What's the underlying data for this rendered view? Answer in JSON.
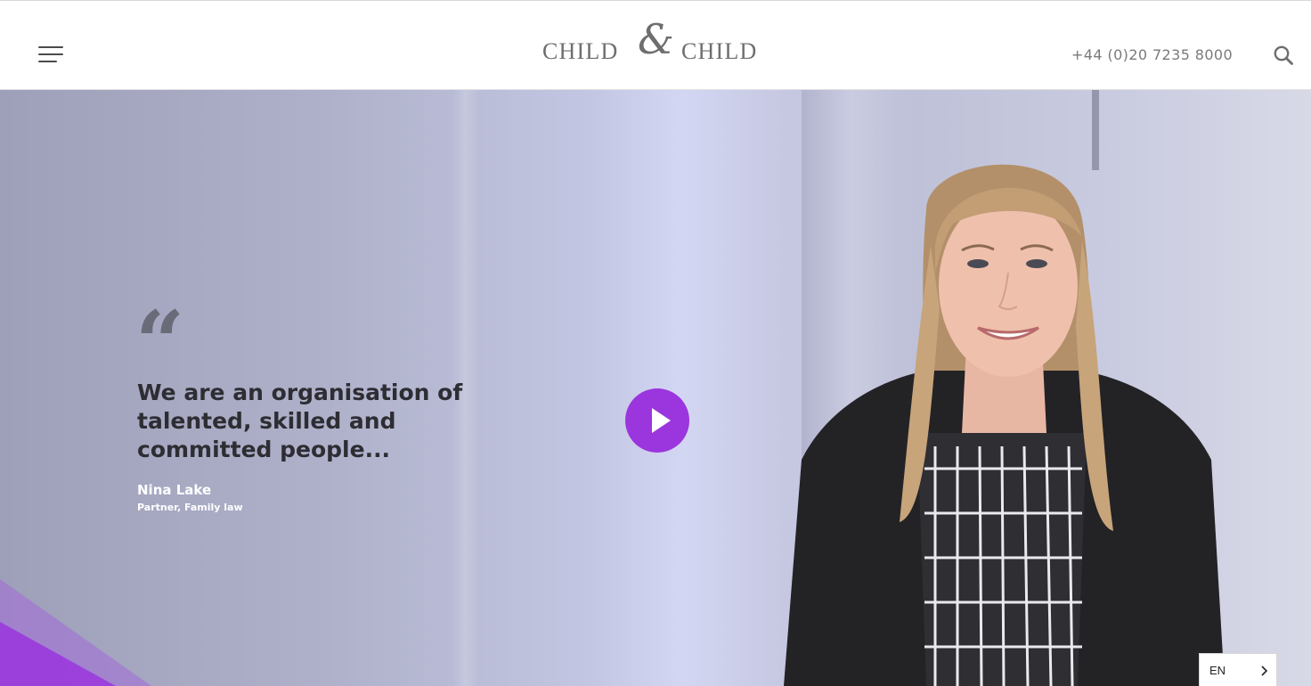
{
  "header": {
    "logo": {
      "word_left": "CHILD",
      "ampersand": "&",
      "word_right": "CHILD"
    },
    "phone": "+44 (0)20 7235 8000",
    "menu_icon": "hamburger-menu-icon",
    "search_icon": "search-icon"
  },
  "hero": {
    "quote_mark": "“",
    "quote": "We are an organisation of talented, skilled and committed people...",
    "author_name": "Nina Lake",
    "author_role": "Partner, Family law",
    "play_icon": "play-icon"
  },
  "language": {
    "code": "EN",
    "icon": "chevron-right-icon"
  },
  "colors": {
    "accent": "#9b35de",
    "header_bg": "#ffffff",
    "logo_text": "#6e6e6e",
    "quote_text": "#2d2d33"
  }
}
